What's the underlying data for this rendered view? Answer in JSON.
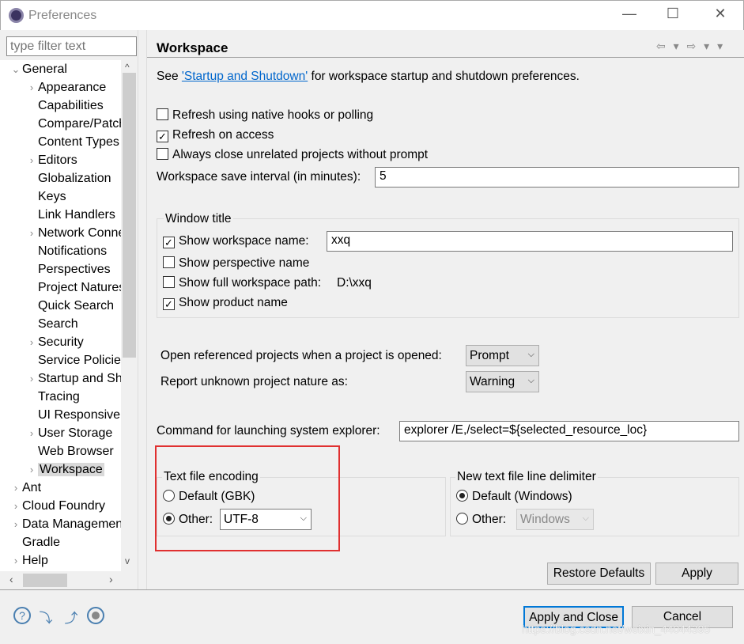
{
  "window": {
    "title": "Preferences",
    "minimize": "—",
    "maximize": "☐",
    "close": "✕"
  },
  "sidebar": {
    "filter_placeholder": "type filter text",
    "items": [
      {
        "label": "General",
        "level": 0,
        "chevron": "v"
      },
      {
        "label": "Appearance",
        "level": 1,
        "chevron": ">"
      },
      {
        "label": "Capabilities",
        "level": 1,
        "chevron": ""
      },
      {
        "label": "Compare/Patch",
        "level": 1,
        "chevron": ""
      },
      {
        "label": "Content Types",
        "level": 1,
        "chevron": ""
      },
      {
        "label": "Editors",
        "level": 1,
        "chevron": ">"
      },
      {
        "label": "Globalization",
        "level": 1,
        "chevron": ""
      },
      {
        "label": "Keys",
        "level": 1,
        "chevron": ""
      },
      {
        "label": "Link Handlers",
        "level": 1,
        "chevron": ""
      },
      {
        "label": "Network Connections",
        "level": 1,
        "chevron": ">"
      },
      {
        "label": "Notifications",
        "level": 1,
        "chevron": ""
      },
      {
        "label": "Perspectives",
        "level": 1,
        "chevron": ""
      },
      {
        "label": "Project Natures",
        "level": 1,
        "chevron": ""
      },
      {
        "label": "Quick Search",
        "level": 1,
        "chevron": ""
      },
      {
        "label": "Search",
        "level": 1,
        "chevron": ""
      },
      {
        "label": "Security",
        "level": 1,
        "chevron": ">"
      },
      {
        "label": "Service Policies",
        "level": 1,
        "chevron": ""
      },
      {
        "label": "Startup and Shutdown",
        "level": 1,
        "chevron": ">"
      },
      {
        "label": "Tracing",
        "level": 1,
        "chevron": ""
      },
      {
        "label": "UI Responsiveness",
        "level": 1,
        "chevron": ""
      },
      {
        "label": "User Storage",
        "level": 1,
        "chevron": ">"
      },
      {
        "label": "Web Browser",
        "level": 1,
        "chevron": ""
      },
      {
        "label": "Workspace",
        "level": 1,
        "chevron": ">",
        "selected": true
      },
      {
        "label": "Ant",
        "level": 0,
        "chevron": ">"
      },
      {
        "label": "Cloud Foundry",
        "level": 0,
        "chevron": ">"
      },
      {
        "label": "Data Management",
        "level": 0,
        "chevron": ">"
      },
      {
        "label": "Gradle",
        "level": 0,
        "chevron": ""
      },
      {
        "label": "Help",
        "level": 0,
        "chevron": ">"
      }
    ]
  },
  "page": {
    "title": "Workspace",
    "nav_icons": "⇦ ▾ ⇨ ▾ ▾",
    "see_prefix": "See ",
    "see_link": "'Startup and Shutdown'",
    "see_suffix": " for workspace startup and shutdown preferences.",
    "refresh_native": {
      "label": "Refresh using native hooks or polling",
      "checked": false
    },
    "refresh_access": {
      "label": "Refresh on access",
      "checked": true
    },
    "always_close": {
      "label": "Always close unrelated projects without prompt",
      "checked": false
    },
    "save_interval_label": "Workspace save interval (in minutes):",
    "save_interval": "5",
    "window_title": {
      "label": "Window title",
      "show_ws_name": {
        "label": "Show workspace name:",
        "checked": true,
        "value": "xxq"
      },
      "show_persp": {
        "label": "Show perspective name",
        "checked": false
      },
      "show_full_path": {
        "label": "Show full workspace path:",
        "checked": false,
        "value": "D:\\xxq"
      },
      "show_product": {
        "label": "Show product name",
        "checked": true
      }
    },
    "open_ref_label": "Open referenced projects when a project is opened:",
    "open_ref_value": "Prompt",
    "report_nature_label": "Report unknown project nature as:",
    "report_nature_value": "Warning",
    "explorer_label": "Command for launching system explorer:",
    "explorer_value": "explorer /E,/select=${selected_resource_loc}",
    "encoding": {
      "label": "Text file encoding",
      "default": "Default (GBK)",
      "other": "Other:",
      "value": "UTF-8",
      "selected": "other"
    },
    "delimiter": {
      "label": "New text file line delimiter",
      "default": "Default (Windows)",
      "other": "Other:",
      "value": "Windows",
      "selected": "default"
    },
    "restore_defaults": "Restore Defaults",
    "apply": "Apply",
    "highlight_color": "#e03030"
  },
  "footer": {
    "apply_close": "Apply and Close",
    "cancel": "Cancel",
    "watermark": "https://blog.csdn.net/weixin_44044395"
  }
}
